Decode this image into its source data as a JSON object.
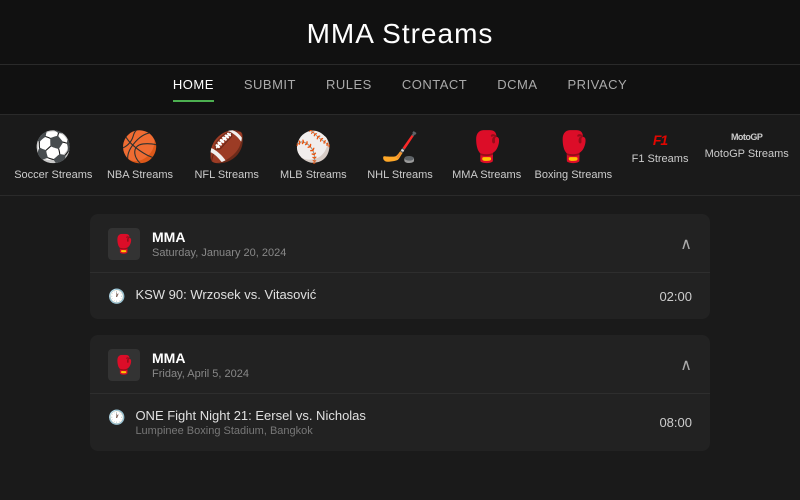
{
  "header": {
    "title": "MMA Streams"
  },
  "nav": {
    "items": [
      {
        "label": "HOME",
        "id": "home",
        "active": true
      },
      {
        "label": "SUBMIT",
        "id": "submit",
        "active": false
      },
      {
        "label": "RULES",
        "id": "rules",
        "active": false
      },
      {
        "label": "CONTACT",
        "id": "contact",
        "active": false
      },
      {
        "label": "DCMA",
        "id": "dcma",
        "active": false
      },
      {
        "label": "PRIVACY",
        "id": "privacy",
        "active": false
      }
    ]
  },
  "sports": [
    {
      "label": "Soccer Streams",
      "icon": "⚽",
      "id": "soccer"
    },
    {
      "label": "NBA Streams",
      "icon": "🏀",
      "id": "nba"
    },
    {
      "label": "NFL Streams",
      "icon": "🏈",
      "id": "nfl"
    },
    {
      "label": "MLB Streams",
      "icon": "⚾",
      "id": "mlb"
    },
    {
      "label": "NHL Streams",
      "icon": "🏒",
      "id": "nhl"
    },
    {
      "label": "MMA Streams",
      "icon": "🥊",
      "id": "mma"
    },
    {
      "label": "Boxing Streams",
      "icon": "🥊",
      "id": "boxing"
    },
    {
      "label": "F1 Streams",
      "icon": "F1",
      "id": "f1"
    },
    {
      "label": "MotoGP Streams",
      "icon": "MotoGP",
      "id": "motogp"
    }
  ],
  "events": [
    {
      "id": "event1",
      "sport": "MMA",
      "sport_icon": "🥊",
      "title": "MMA",
      "date": "Saturday, January 20, 2024",
      "expanded": true,
      "matches": [
        {
          "name": "KSW 90: Wrzosek vs. Vitasović",
          "venue": "",
          "time": "02:00"
        }
      ]
    },
    {
      "id": "event2",
      "sport": "MMA",
      "sport_icon": "🥊",
      "title": "MMA",
      "date": "Friday, April 5, 2024",
      "expanded": true,
      "matches": [
        {
          "name": "ONE Fight Night 21: Eersel vs. Nicholas",
          "venue": "Lumpinee Boxing Stadium, Bangkok",
          "time": "08:00"
        }
      ]
    }
  ],
  "toggle_icon": "∧"
}
